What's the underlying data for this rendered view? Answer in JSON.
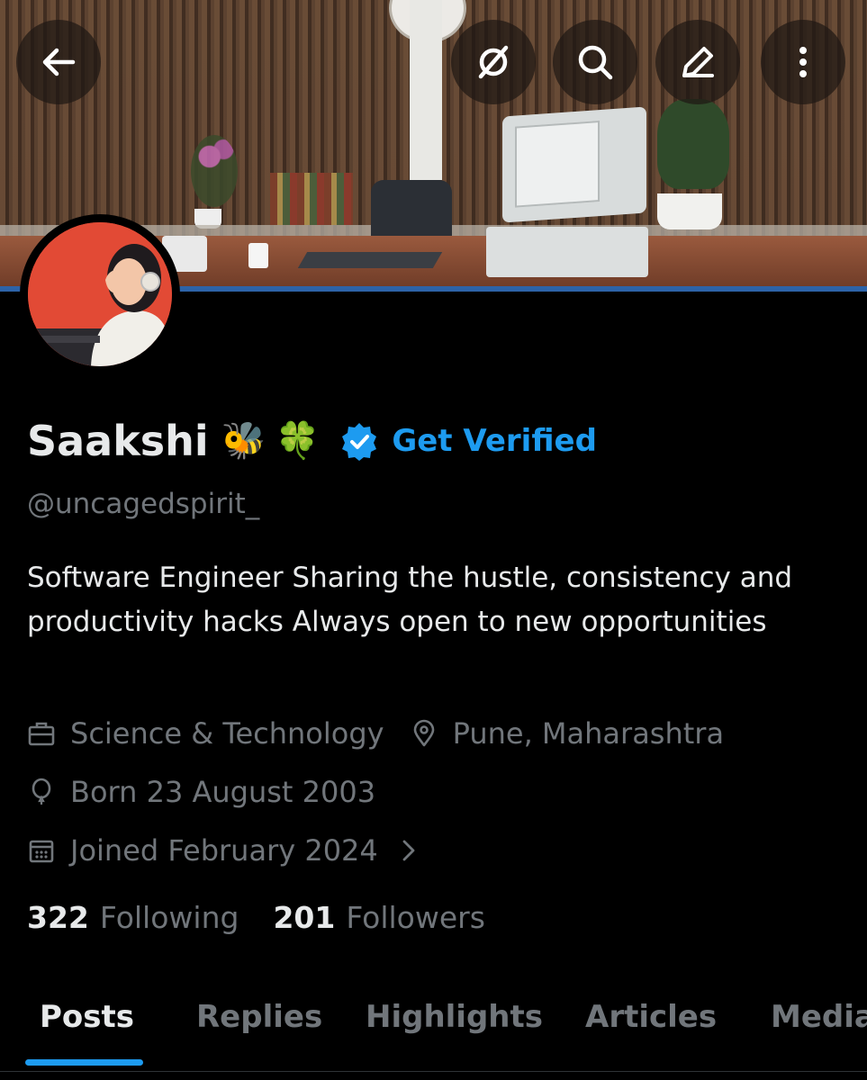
{
  "topbar": {
    "back_icon": "arrow-left-icon",
    "grok_icon": "grok-icon",
    "search_icon": "search-icon",
    "edit_icon": "edit-icon",
    "more_icon": "more-vertical-icon"
  },
  "profile": {
    "name": "Saakshi",
    "name_emojis": [
      "🐝",
      "🍀"
    ],
    "verified_label": "Get Verified",
    "handle": "@uncagedspirit_",
    "bio": "Software Engineer  Sharing the hustle, consistency and productivity hacks Always open to new opportunities",
    "category": "Science & Technology",
    "location": "Pune, Maharashtra",
    "birthday": "Born 23 August 2003",
    "joined": "Joined February 2024"
  },
  "stats": {
    "following_count": "322",
    "following_label": "Following",
    "followers_count": "201",
    "followers_label": "Followers"
  },
  "tabs": [
    {
      "label": "Posts",
      "active": true
    },
    {
      "label": "Replies",
      "active": false
    },
    {
      "label": "Highlights",
      "active": false
    },
    {
      "label": "Articles",
      "active": false
    },
    {
      "label": "Media",
      "active": false
    }
  ],
  "colors": {
    "accent": "#1d9bf0",
    "background": "#000000",
    "text_primary": "#e7e9ea",
    "text_secondary": "#71767b"
  }
}
